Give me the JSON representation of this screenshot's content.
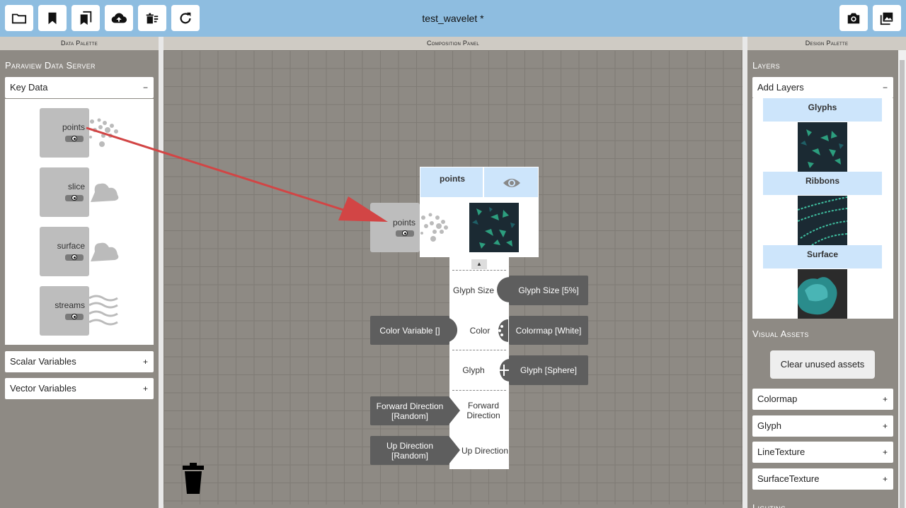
{
  "app": {
    "title": "test_wavelet *"
  },
  "toolbar": {
    "left_buttons": [
      "folder-icon",
      "bookmark-icon",
      "bookmarks-icon",
      "cloud-upload-icon",
      "delete-list-icon",
      "refresh-icon"
    ],
    "right_buttons": [
      "camera-icon",
      "image-icon"
    ]
  },
  "panels": {
    "left_title": "Data Palette",
    "center_title": "Composition Panel",
    "right_title": "Design Palette"
  },
  "data_palette": {
    "server_title": "Paraview Data Server",
    "key_data": {
      "label": "Key Data",
      "sign": "−"
    },
    "tiles": [
      "points",
      "slice",
      "surface",
      "streams"
    ],
    "scalar": {
      "label": "Scalar Variables",
      "sign": "+"
    },
    "vector": {
      "label": "Vector Variables",
      "sign": "+"
    }
  },
  "composition": {
    "dragged_tile": "points",
    "node": {
      "name": "points"
    },
    "props": {
      "glyph_size": "Glyph Size",
      "color": "Color",
      "glyph": "Glyph",
      "forward_direction": "Forward Direction",
      "up_direction": "Up Direction"
    },
    "buttons": {
      "glyph_size": "Glyph Size [5%]",
      "color_variable": "Color Variable []",
      "colormap": "Colormap [White]",
      "glyph": "Glyph [Sphere]",
      "forward_direction": "Forward Direction [Random]",
      "up_direction": "Up Direction [Random]"
    }
  },
  "design_palette": {
    "layers_title": "Layers",
    "add_layers": {
      "label": "Add Layers",
      "sign": "−"
    },
    "layers": [
      "Glyphs",
      "Ribbons",
      "Surface"
    ],
    "visual_assets_title": "Visual Assets",
    "clear_button": "Clear unused assets",
    "assets": [
      {
        "label": "Colormap",
        "sign": "+"
      },
      {
        "label": "Glyph",
        "sign": "+"
      },
      {
        "label": "LineTexture",
        "sign": "+"
      },
      {
        "label": "SurfaceTexture",
        "sign": "+"
      }
    ],
    "lighting_title": "Lighting"
  },
  "colors": {
    "topbar": "#8ebde0",
    "panel": "#8e8a84",
    "layer_header": "#cde5fb",
    "arrow": "#d24545",
    "dark_button": "#5e5e5e"
  }
}
